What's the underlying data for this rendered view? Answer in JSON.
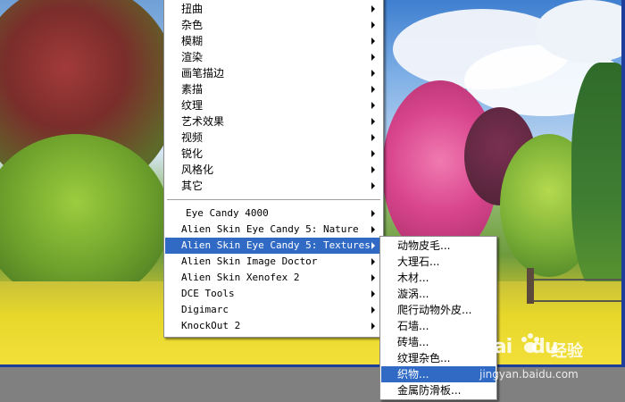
{
  "main_menu": {
    "items": [
      {
        "label": "扭曲",
        "submenu": true
      },
      {
        "label": "杂色",
        "submenu": true
      },
      {
        "label": "模糊",
        "submenu": true
      },
      {
        "label": "渲染",
        "submenu": true
      },
      {
        "label": "画笔描边",
        "submenu": true
      },
      {
        "label": "素描",
        "submenu": true
      },
      {
        "label": "纹理",
        "submenu": true
      },
      {
        "label": "艺术效果",
        "submenu": true
      },
      {
        "label": "视频",
        "submenu": true
      },
      {
        "label": "锐化",
        "submenu": true
      },
      {
        "label": "风格化",
        "submenu": true
      },
      {
        "label": "其它",
        "submenu": true
      }
    ],
    "plugins": [
      {
        "label": "Eye Candy 4000",
        "submenu": true
      },
      {
        "label": "Alien Skin Eye Candy 5: Nature",
        "submenu": true
      },
      {
        "label": "Alien Skin Eye Candy 5: Textures",
        "submenu": true,
        "selected": true
      },
      {
        "label": "Alien Skin Image Doctor",
        "submenu": true
      },
      {
        "label": "Alien Skin Xenofex 2",
        "submenu": true
      },
      {
        "label": "DCE Tools",
        "submenu": true
      },
      {
        "label": "Digimarc",
        "submenu": true
      },
      {
        "label": "KnockOut 2",
        "submenu": true
      }
    ]
  },
  "sub_menu": {
    "items": [
      {
        "label": "动物皮毛..."
      },
      {
        "label": "大理石..."
      },
      {
        "label": "木材..."
      },
      {
        "label": "漩涡..."
      },
      {
        "label": "爬行动物外皮..."
      },
      {
        "label": "石墙..."
      },
      {
        "label": "砖墙..."
      },
      {
        "label": "纹理杂色..."
      },
      {
        "label": "织物...",
        "selected": true
      },
      {
        "label": "金属防滑板..."
      }
    ]
  },
  "watermark": {
    "brand": "Bai",
    "brand_suffix": "du",
    "cn": "经验",
    "url": "jingyan.baidu.com"
  },
  "colors": {
    "selection": "#316ac5",
    "menu_bg": "#ffffff",
    "workspace": "#808080",
    "canvas_border": "#1f3d9a"
  }
}
